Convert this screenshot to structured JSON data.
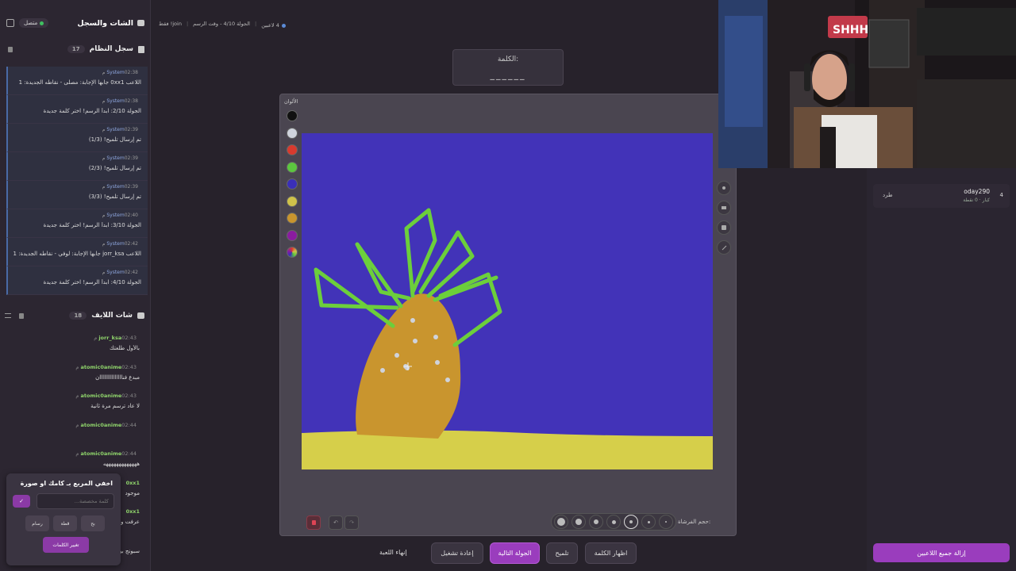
{
  "left_panel": {
    "title": "الشات والسجل",
    "status": "متصل",
    "system_log": {
      "title": "سجل النظام",
      "count": "17",
      "items": [
        {
          "sender": "System",
          "time": "02:38 م",
          "text": "اللاعب 0xx1 جابها الإجابة: مصلى - نقاطه الجديدة: 1"
        },
        {
          "sender": "System",
          "time": "02:38 م",
          "text": "الجولة 2/10: ابدأ الرسم! اختر كلمة جديدة"
        },
        {
          "sender": "System",
          "time": "02:39 م",
          "text": "تم إرسال تلميح! (1/3)"
        },
        {
          "sender": "System",
          "time": "02:39 م",
          "text": "تم إرسال تلميح! (2/3)"
        },
        {
          "sender": "System",
          "time": "02:39 م",
          "text": "تم إرسال تلميح! (3/3)"
        },
        {
          "sender": "System",
          "time": "02:40 م",
          "text": "الجولة 3/10: ابدأ الرسم! اختر كلمة جديدة"
        },
        {
          "sender": "System",
          "time": "02:42 م",
          "text": "اللاعب jorr_ksa جابها الإجابة: لوفي - نقاطه الجديدة: 1"
        },
        {
          "sender": "System",
          "time": "02:42 م",
          "text": "الجولة 4/10: ابدأ الرسم! اختر كلمة جديدة"
        }
      ]
    },
    "live_chat": {
      "title": "شات اللايف",
      "count": "18",
      "items": [
        {
          "user": "jorr_ksa",
          "time": "02:43 م",
          "text": "بالأول طلعتك"
        },
        {
          "user": "atomic0anime",
          "time": "02:43 م",
          "text": "مبدع فنااااااااااااااان"
        },
        {
          "user": "atomic0anime",
          "time": "02:43 م",
          "text": "لا عاد ترسم مرة ثانية"
        },
        {
          "user": "atomic0anime",
          "time": "02:44 م",
          "text": ""
        },
        {
          "user": "atomic0anime",
          "time": "02:44 م",
          "text": "هههههههههههههه"
        },
        {
          "user": "0xx1",
          "time": "",
          "text": "موجود"
        },
        {
          "user": "0xx1",
          "time": "",
          "text": "عرفت وش"
        },
        {
          "user": "",
          "time": "",
          "text": "سبونج بو"
        }
      ]
    }
  },
  "popup": {
    "title": "اخفي المربع بـ كامك او صورة",
    "input_placeholder": "كلمة مخصصة...",
    "confirm": "✓",
    "opt1": "رسام",
    "opt2": "قطة",
    "opt3": "بح",
    "change_words": "تغيير الكلمات"
  },
  "topbar": {
    "players": "4 لاعبين",
    "round": "الجولة 4/10 - وقت الرسم",
    "extra": "join! فقط"
  },
  "word": {
    "label": "الكلمة:",
    "mask": "______"
  },
  "board": {
    "colors_label": "الألوان",
    "colors": [
      "#111111",
      "#cfd3dc",
      "#d83a2e",
      "#5cc73f",
      "#3a2fb8",
      "#cfc24a",
      "#c9952e",
      "#8a1ca0"
    ],
    "brush_label": "حجم الفرشاة:"
  },
  "actions": {
    "end": "إنهاء اللعبة",
    "restart": "إعادة تشغيل",
    "next": "الجولة التالية",
    "hint": "تلميح",
    "reveal": "اظهار الكلمة"
  },
  "players": [
    {
      "name": "oday290",
      "sub": "كبار · 0 نقطة",
      "rank": "4",
      "kick": "طرد"
    }
  ],
  "remove_all": "إزالة جميع اللاعبين"
}
